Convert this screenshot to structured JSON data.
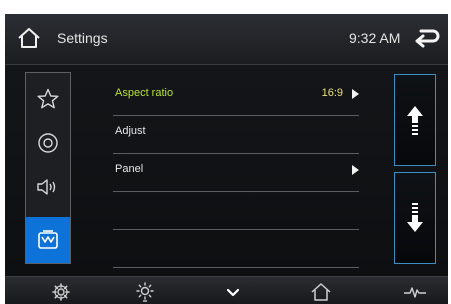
{
  "header": {
    "title": "Settings",
    "time": "9:32 AM"
  },
  "sidebar": {
    "items": [
      {
        "icon": "star-icon",
        "active": false
      },
      {
        "icon": "disc-icon",
        "active": false
      },
      {
        "icon": "speaker-icon",
        "active": false
      },
      {
        "icon": "display-icon",
        "active": true
      }
    ]
  },
  "settings": {
    "rows": [
      {
        "label": "Aspect ratio",
        "value": "16:9",
        "has_arrow": true,
        "selected": true
      },
      {
        "label": "Adjust",
        "value": "",
        "has_arrow": false,
        "selected": false
      },
      {
        "label": "Panel",
        "value": "",
        "has_arrow": true,
        "selected": false
      },
      {
        "label": "",
        "value": "",
        "has_arrow": false,
        "selected": false
      },
      {
        "label": "",
        "value": "",
        "has_arrow": false,
        "selected": false
      }
    ]
  },
  "scroll": {
    "up_icon": "arrow-up-icon",
    "down_icon": "arrow-down-icon"
  },
  "bottom_bar": {
    "icons": [
      "gear-icon",
      "brightness-icon",
      "chevron-down-icon",
      "home-icon",
      "pulse-icon"
    ]
  },
  "colors": {
    "accent_blue": "#0e73d9",
    "selected_label": "#b7e23b",
    "value_text": "#e8e17a",
    "scroll_border": "#3a8fc7"
  }
}
